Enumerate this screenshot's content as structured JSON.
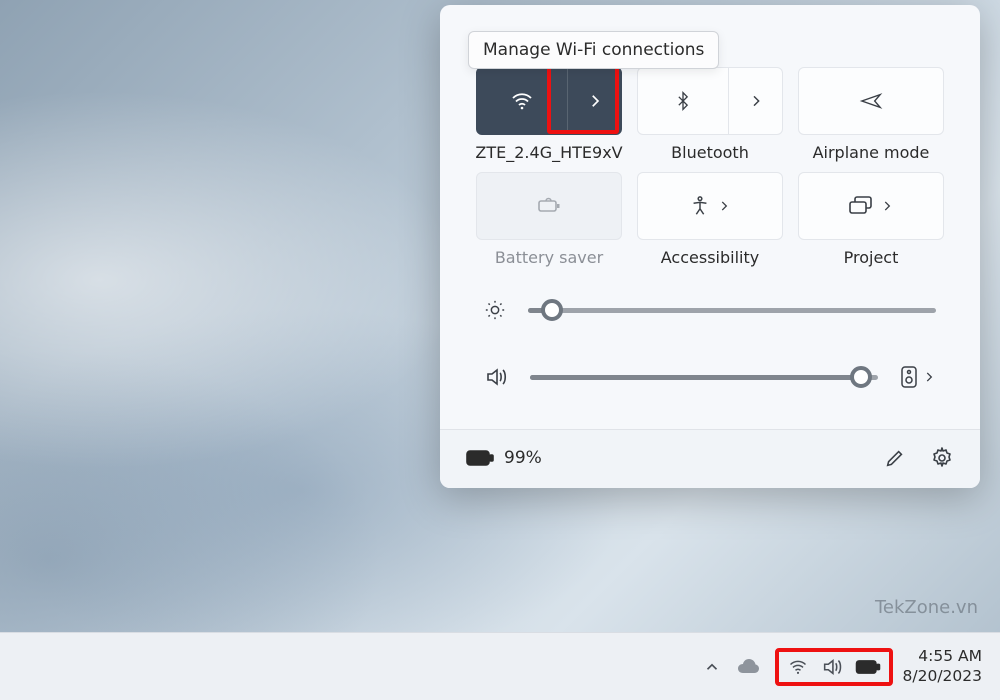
{
  "tooltip": {
    "wifi_manage": "Manage Wi-Fi connections"
  },
  "tiles": {
    "wifi": {
      "label": "ZTE_2.4G_HTE9xV"
    },
    "bluetooth": {
      "label": "Bluetooth"
    },
    "airplane": {
      "label": "Airplane mode"
    },
    "battsaver": {
      "label": "Battery saver"
    },
    "access": {
      "label": "Accessibility"
    },
    "project": {
      "label": "Project"
    }
  },
  "sliders": {
    "brightness_pct": 6,
    "volume_pct": 95
  },
  "footer": {
    "battery_text": "99%"
  },
  "watermark": "TekZone.vn",
  "clock": {
    "time": "4:55 AM",
    "date": "8/20/2023"
  }
}
